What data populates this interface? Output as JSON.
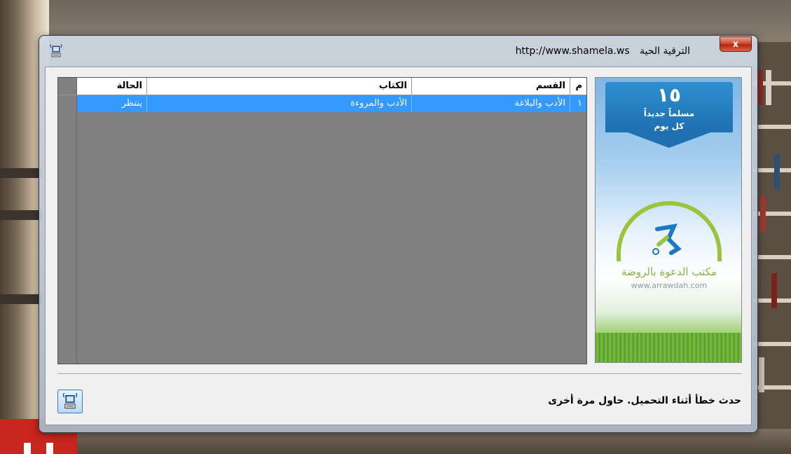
{
  "window": {
    "title_url": "http://www.shamela.ws",
    "title_text": "الترقية الحية",
    "close_label": "x"
  },
  "grid": {
    "columns": [
      "م",
      "القسم",
      "الكتاب",
      "الحالة"
    ],
    "rows": [
      {
        "num": "١",
        "section": "الأدب والبلاغة",
        "book": "الأدب والمروءة",
        "status": "ينتظر"
      }
    ]
  },
  "banner": {
    "count": "١٥",
    "line1": "مسلماً جديداً",
    "line2": "كل يوم",
    "org_name": "مكتب الدعوة بالروضة",
    "org_url": "www.arrawdah.com"
  },
  "status_message": "حدث خطأ أثناء التحميل. حاول مرة أخرى",
  "icons": {
    "app_icon": "computer-broadcast-icon",
    "refresh_icon": "computer-broadcast-icon"
  },
  "colors": {
    "selection": "#3399ff",
    "grid_background": "#808080",
    "close_button": "#c9402a"
  }
}
